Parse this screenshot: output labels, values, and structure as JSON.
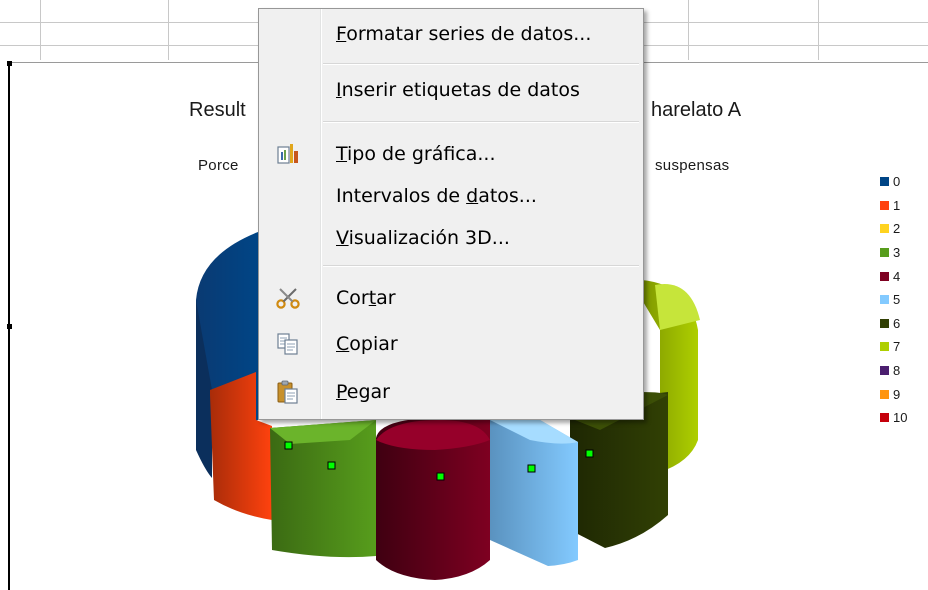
{
  "chart": {
    "title_left": "Result",
    "title_right": "harelato A",
    "subtitle_left": "Porce",
    "subtitle_right": "suspensas"
  },
  "legend": {
    "items": [
      {
        "label": "0",
        "color": "#004586"
      },
      {
        "label": "1",
        "color": "#ff420e"
      },
      {
        "label": "2",
        "color": "#ffd320"
      },
      {
        "label": "3",
        "color": "#579d1c"
      },
      {
        "label": "4",
        "color": "#7e0021"
      },
      {
        "label": "5",
        "color": "#83caff"
      },
      {
        "label": "6",
        "color": "#314004"
      },
      {
        "label": "7",
        "color": "#aecf00"
      },
      {
        "label": "8",
        "color": "#4b1f6f"
      },
      {
        "label": "9",
        "color": "#ff950e"
      },
      {
        "label": "10",
        "color": "#c5000b"
      }
    ]
  },
  "context_menu": {
    "items": [
      {
        "pre": "",
        "u": "F",
        "post": "ormatar series de datos...",
        "icon": ""
      },
      {
        "pre": "",
        "u": "I",
        "post": "nserir etiquetas de datos",
        "icon": ""
      },
      {
        "pre": "",
        "u": "T",
        "post": "ipo de gráfica...",
        "icon": "chart-type-icon"
      },
      {
        "pre": "Intervalos de ",
        "u": "d",
        "post": "atos...",
        "icon": ""
      },
      {
        "pre": "",
        "u": "V",
        "post": "isualización 3D...",
        "icon": ""
      },
      {
        "pre": "Cor",
        "u": "t",
        "post": "ar",
        "icon": "scissors-icon"
      },
      {
        "pre": "",
        "u": "C",
        "post": "opiar",
        "icon": "copy-icon"
      },
      {
        "pre": "",
        "u": "P",
        "post": "egar",
        "icon": "paste-icon"
      }
    ]
  }
}
